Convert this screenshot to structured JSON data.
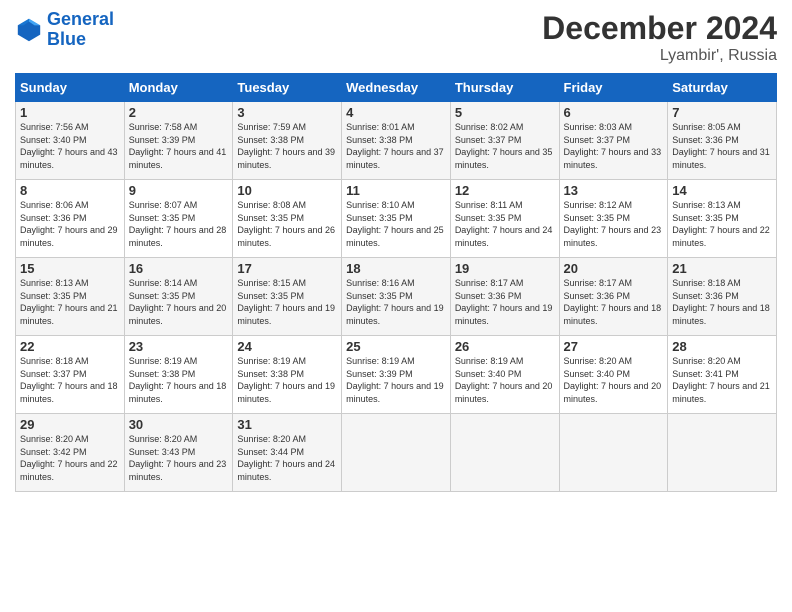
{
  "header": {
    "logo_line1": "General",
    "logo_line2": "Blue",
    "month": "December 2024",
    "location": "Lyambir', Russia"
  },
  "days_of_week": [
    "Sunday",
    "Monday",
    "Tuesday",
    "Wednesday",
    "Thursday",
    "Friday",
    "Saturday"
  ],
  "weeks": [
    [
      {
        "num": "1",
        "sunrise": "7:56 AM",
        "sunset": "3:40 PM",
        "daylight": "7 hours and 43 minutes."
      },
      {
        "num": "2",
        "sunrise": "7:58 AM",
        "sunset": "3:39 PM",
        "daylight": "7 hours and 41 minutes."
      },
      {
        "num": "3",
        "sunrise": "7:59 AM",
        "sunset": "3:38 PM",
        "daylight": "7 hours and 39 minutes."
      },
      {
        "num": "4",
        "sunrise": "8:01 AM",
        "sunset": "3:38 PM",
        "daylight": "7 hours and 37 minutes."
      },
      {
        "num": "5",
        "sunrise": "8:02 AM",
        "sunset": "3:37 PM",
        "daylight": "7 hours and 35 minutes."
      },
      {
        "num": "6",
        "sunrise": "8:03 AM",
        "sunset": "3:37 PM",
        "daylight": "7 hours and 33 minutes."
      },
      {
        "num": "7",
        "sunrise": "8:05 AM",
        "sunset": "3:36 PM",
        "daylight": "7 hours and 31 minutes."
      }
    ],
    [
      {
        "num": "8",
        "sunrise": "8:06 AM",
        "sunset": "3:36 PM",
        "daylight": "7 hours and 29 minutes."
      },
      {
        "num": "9",
        "sunrise": "8:07 AM",
        "sunset": "3:35 PM",
        "daylight": "7 hours and 28 minutes."
      },
      {
        "num": "10",
        "sunrise": "8:08 AM",
        "sunset": "3:35 PM",
        "daylight": "7 hours and 26 minutes."
      },
      {
        "num": "11",
        "sunrise": "8:10 AM",
        "sunset": "3:35 PM",
        "daylight": "7 hours and 25 minutes."
      },
      {
        "num": "12",
        "sunrise": "8:11 AM",
        "sunset": "3:35 PM",
        "daylight": "7 hours and 24 minutes."
      },
      {
        "num": "13",
        "sunrise": "8:12 AM",
        "sunset": "3:35 PM",
        "daylight": "7 hours and 23 minutes."
      },
      {
        "num": "14",
        "sunrise": "8:13 AM",
        "sunset": "3:35 PM",
        "daylight": "7 hours and 22 minutes."
      }
    ],
    [
      {
        "num": "15",
        "sunrise": "8:13 AM",
        "sunset": "3:35 PM",
        "daylight": "7 hours and 21 minutes."
      },
      {
        "num": "16",
        "sunrise": "8:14 AM",
        "sunset": "3:35 PM",
        "daylight": "7 hours and 20 minutes."
      },
      {
        "num": "17",
        "sunrise": "8:15 AM",
        "sunset": "3:35 PM",
        "daylight": "7 hours and 19 minutes."
      },
      {
        "num": "18",
        "sunrise": "8:16 AM",
        "sunset": "3:35 PM",
        "daylight": "7 hours and 19 minutes."
      },
      {
        "num": "19",
        "sunrise": "8:17 AM",
        "sunset": "3:36 PM",
        "daylight": "7 hours and 19 minutes."
      },
      {
        "num": "20",
        "sunrise": "8:17 AM",
        "sunset": "3:36 PM",
        "daylight": "7 hours and 18 minutes."
      },
      {
        "num": "21",
        "sunrise": "8:18 AM",
        "sunset": "3:36 PM",
        "daylight": "7 hours and 18 minutes."
      }
    ],
    [
      {
        "num": "22",
        "sunrise": "8:18 AM",
        "sunset": "3:37 PM",
        "daylight": "7 hours and 18 minutes."
      },
      {
        "num": "23",
        "sunrise": "8:19 AM",
        "sunset": "3:38 PM",
        "daylight": "7 hours and 18 minutes."
      },
      {
        "num": "24",
        "sunrise": "8:19 AM",
        "sunset": "3:38 PM",
        "daylight": "7 hours and 19 minutes."
      },
      {
        "num": "25",
        "sunrise": "8:19 AM",
        "sunset": "3:39 PM",
        "daylight": "7 hours and 19 minutes."
      },
      {
        "num": "26",
        "sunrise": "8:19 AM",
        "sunset": "3:40 PM",
        "daylight": "7 hours and 20 minutes."
      },
      {
        "num": "27",
        "sunrise": "8:20 AM",
        "sunset": "3:40 PM",
        "daylight": "7 hours and 20 minutes."
      },
      {
        "num": "28",
        "sunrise": "8:20 AM",
        "sunset": "3:41 PM",
        "daylight": "7 hours and 21 minutes."
      }
    ],
    [
      {
        "num": "29",
        "sunrise": "8:20 AM",
        "sunset": "3:42 PM",
        "daylight": "7 hours and 22 minutes."
      },
      {
        "num": "30",
        "sunrise": "8:20 AM",
        "sunset": "3:43 PM",
        "daylight": "7 hours and 23 minutes."
      },
      {
        "num": "31",
        "sunrise": "8:20 AM",
        "sunset": "3:44 PM",
        "daylight": "7 hours and 24 minutes."
      },
      null,
      null,
      null,
      null
    ]
  ]
}
